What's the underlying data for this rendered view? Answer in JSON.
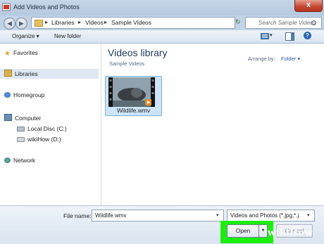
{
  "window": {
    "title": "Add Videos and Photos",
    "close_glyph": "x"
  },
  "address": {
    "crumbs": [
      "Libraries",
      "Videos",
      "Sample Videos"
    ],
    "separator": "▸"
  },
  "search": {
    "placeholder": "Search Sample Videos"
  },
  "toolbar": {
    "organize_label": "Organize ▾",
    "new_folder_label": "New folder",
    "help_glyph": "?"
  },
  "nav": {
    "favorites": "Favorites",
    "libraries": "Libraries",
    "homegroup": "Homegroup",
    "computer": "Computer",
    "local_disc": "Local Disc (C:)",
    "wikihow_drive": "wikiHow (D:)",
    "network": "Network"
  },
  "content": {
    "title": "Videos library",
    "subtitle": "Sample Videos",
    "arrange_label": "Arrange by:",
    "arrange_value": "Folder ▾",
    "files": [
      {
        "name": "Wildlife.wmv"
      }
    ]
  },
  "bottom": {
    "file_name_label": "File name:",
    "file_name_value": "Wildlife.wmv",
    "file_type_value": "Videos and Photos (*.jpg;*.j",
    "open_label": "Open",
    "cancel_label": "Cancel"
  },
  "watermark": {
    "wiki": "wiki",
    "how": "How"
  },
  "colors": {
    "highlight": "#19f00a",
    "titlebar": "#c6d6ea",
    "selection": "#cde3f7"
  }
}
